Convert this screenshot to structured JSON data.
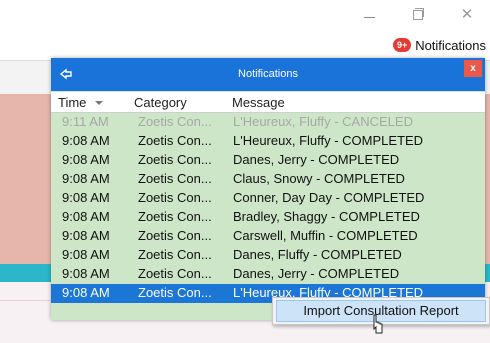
{
  "app": {
    "notifications_badge": "9+",
    "notifications_label": "Notifications"
  },
  "popup": {
    "title": "Notifications",
    "close_label": "x",
    "columns": {
      "time": "Time",
      "category": "Category",
      "message": "Message"
    },
    "rows": [
      {
        "time": "9:11 AM",
        "category": "Zoetis Con...",
        "message": "L'Heureux, Fluffy - CANCELED",
        "state": "dim"
      },
      {
        "time": "9:08 AM",
        "category": "Zoetis Con...",
        "message": "L'Heureux, Fluffy - COMPLETED",
        "state": "normal"
      },
      {
        "time": "9:08 AM",
        "category": "Zoetis Con...",
        "message": "Danes, Jerry - COMPLETED",
        "state": "normal"
      },
      {
        "time": "9:08 AM",
        "category": "Zoetis Con...",
        "message": "Claus, Snowy - COMPLETED",
        "state": "normal"
      },
      {
        "time": "9:08 AM",
        "category": "Zoetis Con...",
        "message": "Conner, Day Day - COMPLETED",
        "state": "normal"
      },
      {
        "time": "9:08 AM",
        "category": "Zoetis Con...",
        "message": "Bradley, Shaggy - COMPLETED",
        "state": "normal"
      },
      {
        "time": "9:08 AM",
        "category": "Zoetis Con...",
        "message": "Carswell, Muffin - COMPLETED",
        "state": "normal"
      },
      {
        "time": "9:08 AM",
        "category": "Zoetis Con...",
        "message": "Danes, Fluffy - COMPLETED",
        "state": "normal"
      },
      {
        "time": "9:08 AM",
        "category": "Zoetis Con...",
        "message": "Danes, Jerry - COMPLETED",
        "state": "normal"
      },
      {
        "time": "9:08 AM",
        "category": "Zoetis Con...",
        "message": "L'Heureux, Fluffy - COMPLETED",
        "state": "selected"
      }
    ]
  },
  "context_menu": {
    "items": [
      "Import Consultation Report"
    ]
  },
  "colors": {
    "header_blue": "#1a73d9",
    "row_green": "#cde6c7",
    "selected_blue": "#1c76d6",
    "teal_strip": "#2bb7c9"
  }
}
